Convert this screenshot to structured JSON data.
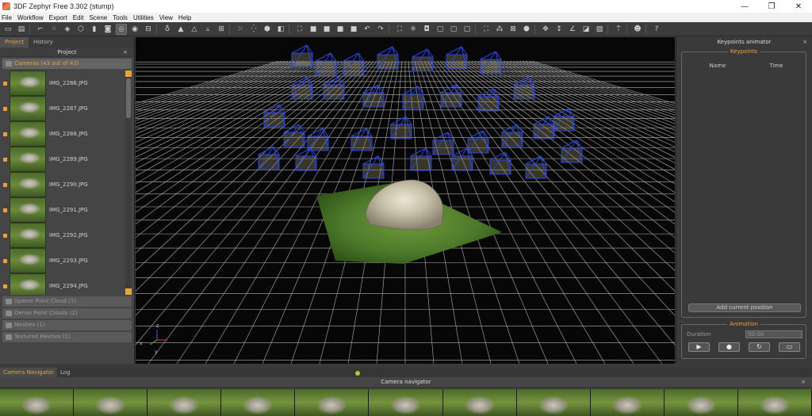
{
  "window": {
    "title": "3DF Zephyr Free 3.302 (stump)",
    "controls": [
      "—",
      "❐",
      "✕"
    ]
  },
  "menu": [
    "File",
    "Workflow",
    "Export",
    "Edit",
    "Scene",
    "Tools",
    "Utilities",
    "View",
    "Help"
  ],
  "left_panel": {
    "tabs": [
      "Project",
      "History"
    ],
    "header": "Project",
    "close": "×",
    "cameras_section": "Cameras (43 out of 43)",
    "cameras": [
      "IMG_2286.JPG",
      "IMG_2287.JPG",
      "IMG_2288.JPG",
      "IMG_2289.JPG",
      "IMG_2290.JPG",
      "IMG_2291.JPG",
      "IMG_2292.JPG",
      "IMG_2293.JPG",
      "IMG_2294.JPG"
    ],
    "sections": [
      "Sparse Point Cloud (1)",
      "Dense Point Clouds (2)",
      "Meshes (1)",
      "Textured Meshes (1)"
    ]
  },
  "right_panel": {
    "header": "Keypoints animator",
    "close": "×",
    "keypoints_legend": "Keypoints",
    "col_name": "Name",
    "col_time": "Time",
    "add_button": "Add current position",
    "animation_legend": "Animation",
    "duration_label": "Duration",
    "duration_value": "00:00",
    "controls": [
      "▶",
      "●",
      "↻",
      "▭"
    ]
  },
  "viewport": {
    "axis_labels": [
      "z",
      "x",
      "y"
    ]
  },
  "bottom": {
    "tabs": [
      "Camera Navigator",
      "Log"
    ],
    "header": "Camera navigator",
    "close": "×"
  },
  "colors": {
    "accent": "#e8a33a",
    "grid": "#cfcfcf",
    "camera_frustum": "#2b46d8"
  }
}
